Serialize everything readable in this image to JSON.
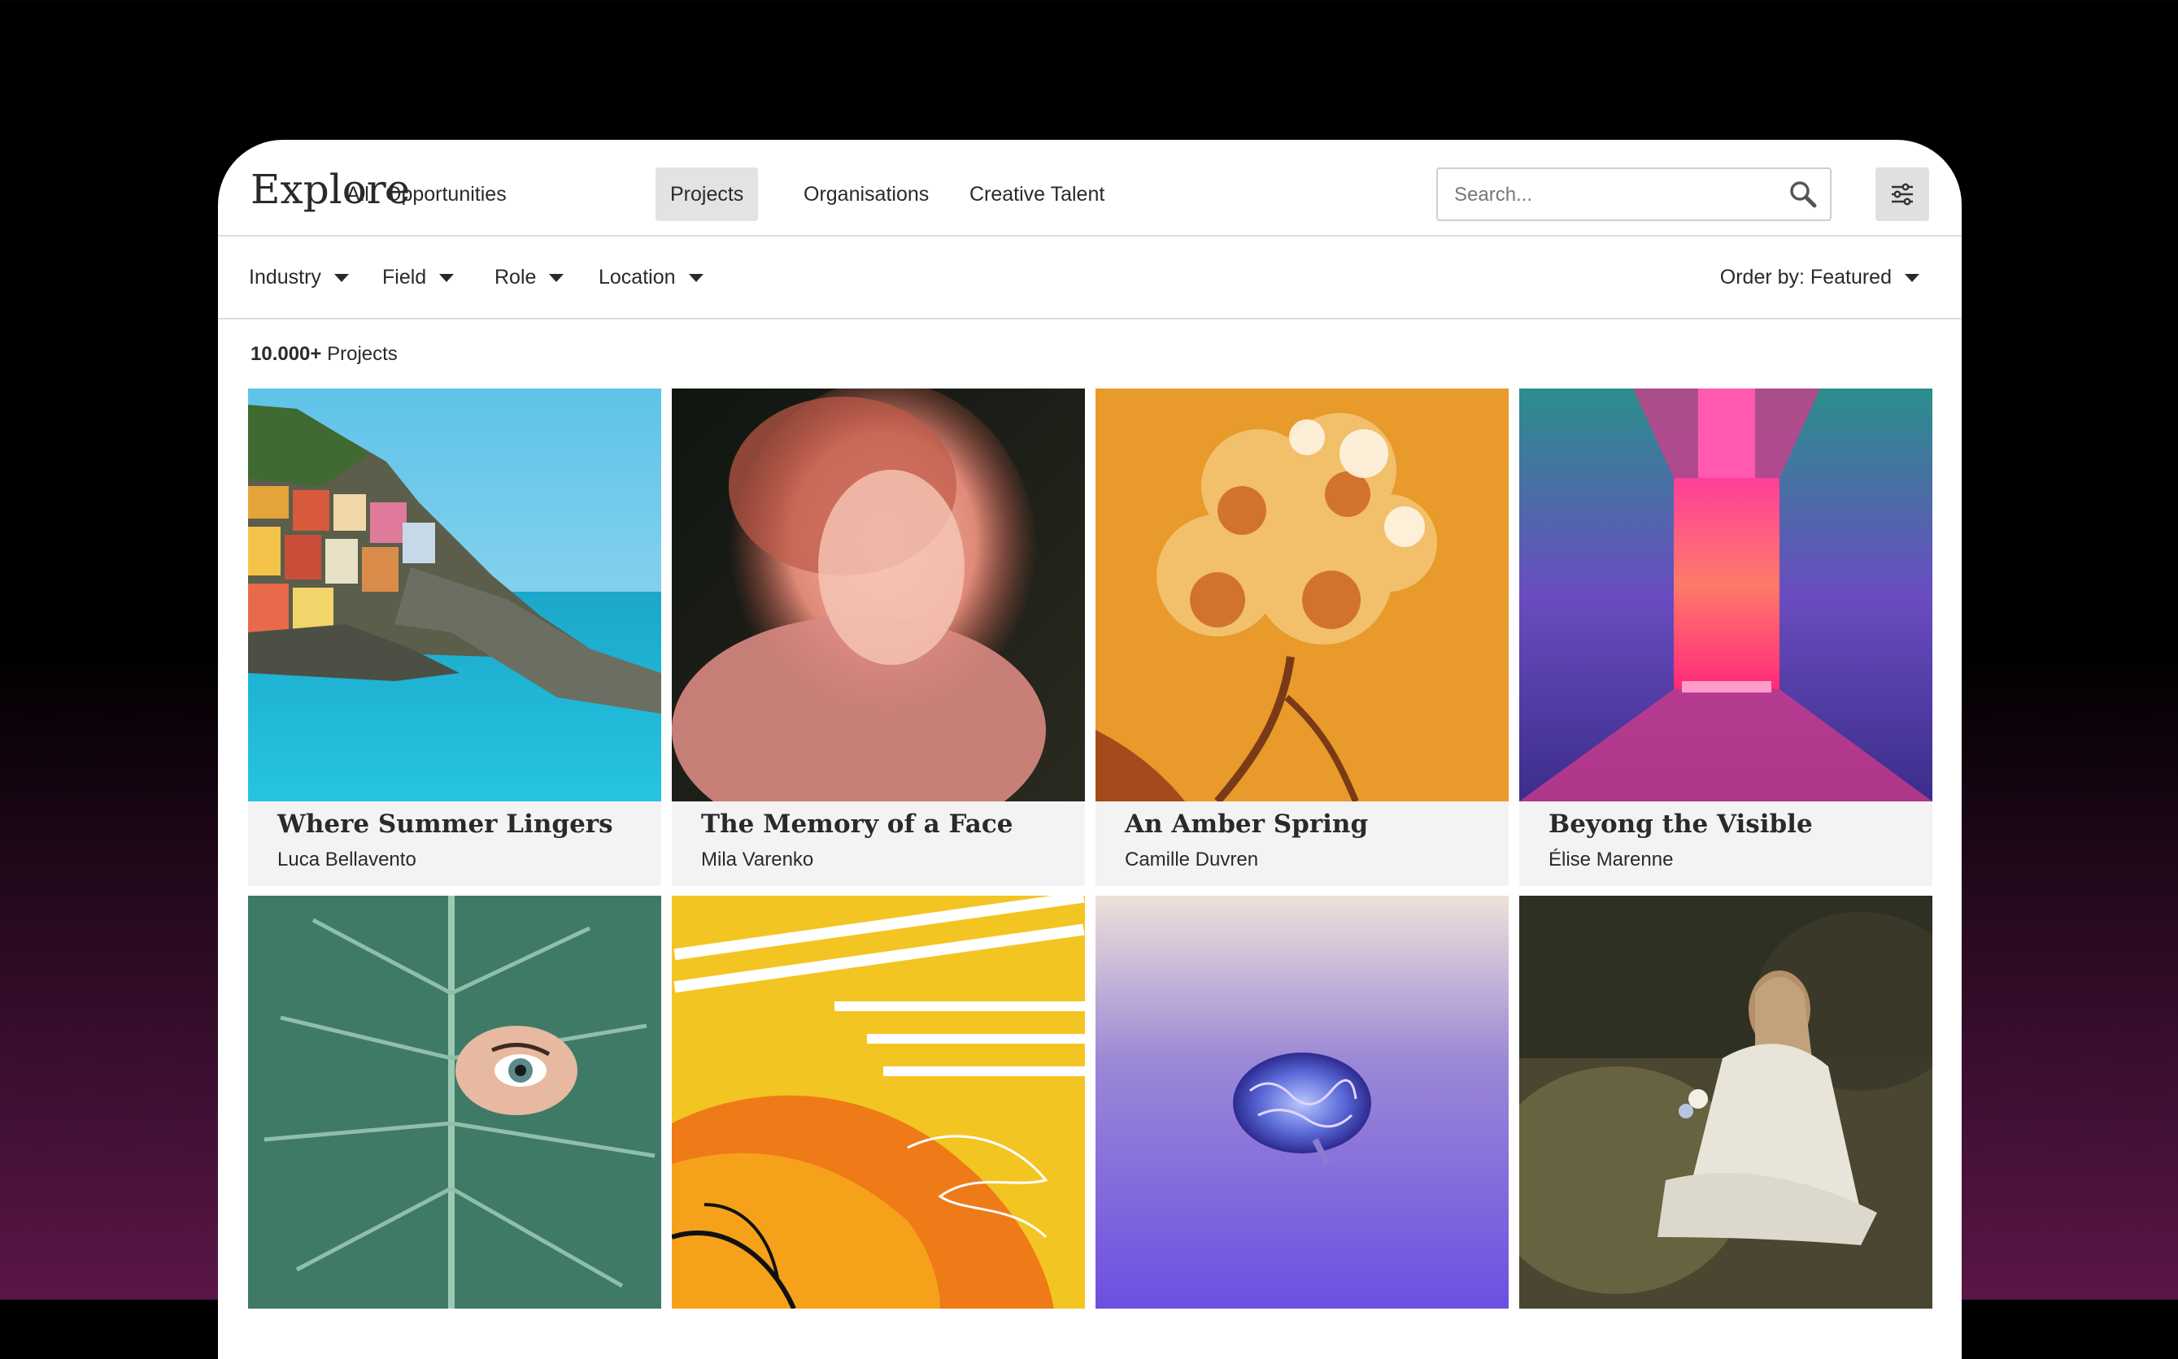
{
  "header": {
    "title": "Explore",
    "tabs": [
      {
        "label": "All"
      },
      {
        "label": "Opportunities"
      },
      {
        "label": "Projects"
      },
      {
        "label": "Organisations"
      },
      {
        "label": "Creative Talent"
      }
    ],
    "active_tab": "Projects",
    "search_placeholder": "Search..."
  },
  "filters": {
    "items": [
      {
        "label": "Industry"
      },
      {
        "label": "Field"
      },
      {
        "label": "Role"
      },
      {
        "label": "Location"
      }
    ],
    "order_label": "Order by: Featured"
  },
  "results": {
    "count": "10.000+",
    "count_suffix": " Projects"
  },
  "cards": [
    {
      "title": "Where Summer Lingers",
      "author": "Luca Bellavento",
      "image": "coastal-village-photo"
    },
    {
      "title": "The Memory of a Face",
      "author": "Mila Varenko",
      "image": "blurred-portrait-photo"
    },
    {
      "title": "An Amber Spring",
      "author": "Camille Duvren",
      "image": "orange-flower-photo"
    },
    {
      "title": "Beyong the Visible",
      "author": "Élise Marenne",
      "image": "neon-corridor-photo"
    },
    {
      "image": "leaf-eye-photo"
    },
    {
      "image": "abstract-paint-photo"
    },
    {
      "image": "glowing-brain-photo"
    },
    {
      "image": "girl-painting-photo"
    }
  ],
  "colors": {
    "active_tab_bg": "#e3e3e3",
    "caption_bg": "#f3f3f3",
    "text": "#2a2a2a"
  }
}
